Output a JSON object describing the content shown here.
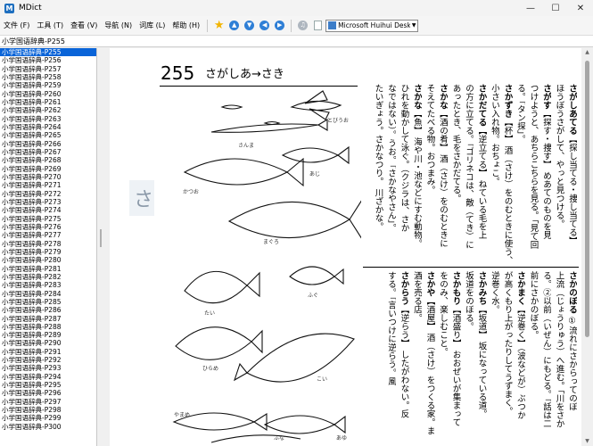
{
  "window": {
    "title": "MDict"
  },
  "menu": [
    "文件 (F)",
    "工具 (T)",
    "查看 (V)",
    "导航 (N)",
    "词库 (L)",
    "帮助 (H)"
  ],
  "font_select": {
    "value": "Microsoft Huihui Desktop - C"
  },
  "headword": "小学国语辞典-P255",
  "list": [
    "小学国语辞典-P255",
    "小学国语辞典-P256",
    "小学国语辞典-P257",
    "小学国语辞典-P258",
    "小学国语辞典-P259",
    "小学国语辞典-P260",
    "小学国语辞典-P261",
    "小学国语辞典-P262",
    "小学国语辞典-P263",
    "小学国语辞典-P264",
    "小学国语辞典-P265",
    "小学国语辞典-P266",
    "小学国语辞典-P267",
    "小学国语辞典-P268",
    "小学国语辞典-P269",
    "小学国语辞典-P270",
    "小学国语辞典-P271",
    "小学国语辞典-P272",
    "小学国语辞典-P273",
    "小学国语辞典-P274",
    "小学国语辞典-P275",
    "小学国语辞典-P276",
    "小学国语辞典-P277",
    "小学国语辞典-P278",
    "小学国语辞典-P279",
    "小学国语辞典-P280",
    "小学国语辞典-P281",
    "小学国语辞典-P282",
    "小学国语辞典-P283",
    "小学国语辞典-P284",
    "小学国语辞典-P285",
    "小学国语辞典-P286",
    "小学国语辞典-P287",
    "小学国语辞典-P288",
    "小学国语辞典-P289",
    "小学国语辞典-P290",
    "小学国语辞典-P291",
    "小学国语辞典-P292",
    "小学国语辞典-P293",
    "小学国语辞典-P294",
    "小学国语辞典-P295",
    "小学国语辞典-P296",
    "小学国语辞典-P297",
    "小学国语辞典-P298",
    "小学国语辞典-P299",
    "小学国语辞典-P300"
  ],
  "selected_index": 0,
  "page": {
    "number": "255",
    "heading": "さがしあ→さき",
    "ghost_char": "さ",
    "fish_labels": [
      "とびうお",
      "さんま",
      "あじ",
      "かつお",
      "まぐろ",
      "たい",
      "ふぐ",
      "ひらめ",
      "こい",
      "やまめ",
      "ふな",
      "あゆ"
    ],
    "columns_top": [
      "<b>さがしあてる</b>【探し当てる・捜し当てる】",
      "ほうぼうさがして、やっと見つける。",
      "<b>さがす</b>【探す・捜す】 めあてのものを見",
      "つけようと、あちらこちらを見る。「見て回",
      "る。「タン探」。",
      "<b>さかずき</b>【杯】 酒（さけ）をのむときに使う、",
      "小さい入れ物。おちょこ。",
      "<b>さかだてる</b>【逆立てる】 ねている毛を上",
      "の方に立てる。「ゴリネコは、敵（てき）に",
      "あったとき、毛をさかだてる。",
      "<b>さかな</b>【酒の肴】 酒（さけ）をのむときに",
      "そえてたべる物。おつまみ。",
      "<b>さかな</b>【魚】 海や川・池などにすむ動物。",
      "ひれを動かして泳ぐ。（クジラは、さか",
      "なではない）。うお。「さかなやさん」。",
      "たいぎょう。さかなつり。 川ざかな。"
    ],
    "columns_bottom": [
      "<b>さかのぼる</b> ①流れにさからってのぼ",
      "上流（じょうりゅう）へ進む。「川をさか",
      "る。②以前（いぜん）にもどる。「話は二",
      "前にさかのぼる。",
      "<b>さかまく</b>【逆巻く】（波などが）ぶつか",
      "が高くもり上がったりしてうずまく。",
      "逆巻く水。",
      "<b>さかみち</b>【坂道】 坂になっている道。",
      "坂道をのぼる。",
      "<b>さかもり</b>【酒盛り】 おおぜいが集まって",
      "をのみ、楽しむこと。",
      "<b>さかや</b>【酒屋】 酒（さけ）をつくる家。ま",
      "酒を売る店。",
      "<b>さからう</b>【逆らう】 したがわない。反",
      "する。「言いつけに逆らう。風"
    ]
  }
}
